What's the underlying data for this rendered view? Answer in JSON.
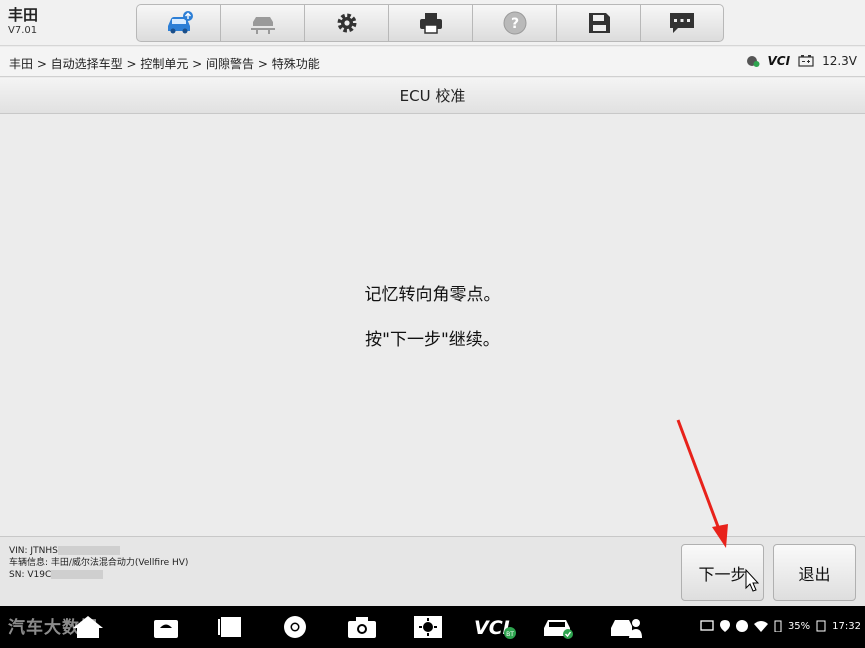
{
  "app": {
    "brand": "丰田",
    "version": "V7.01"
  },
  "toolbar": {
    "items": [
      {
        "icon": "car-home-icon",
        "active": true
      },
      {
        "icon": "car-lift-icon"
      },
      {
        "icon": "gear-icon"
      },
      {
        "icon": "printer-icon"
      },
      {
        "icon": "help-icon"
      },
      {
        "icon": "save-icon"
      },
      {
        "icon": "message-icon"
      }
    ]
  },
  "breadcrumb": "丰田 > 自动选择车型 > 控制单元 > 间隙警告 > 特殊功能",
  "status": {
    "vci_text": "VCI",
    "voltage": "12.3V"
  },
  "page_title": "ECU 校准",
  "messages": {
    "line1": "记忆转向角零点。",
    "line2": "按\"下一步\"继续。"
  },
  "vehicle": {
    "vin_label": "VIN: JTNHS",
    "info": "车辆信息: 丰田/威尔法混合动力(Vellfire HV)",
    "sn_label": "SN: V19C"
  },
  "buttons": {
    "next": "下一步",
    "exit": "退出"
  },
  "system_bar": {
    "battery": "35%",
    "time": "17:32",
    "vci_label": "VCI",
    "bt_badge": "BT"
  },
  "watermark": "汽车大数据"
}
